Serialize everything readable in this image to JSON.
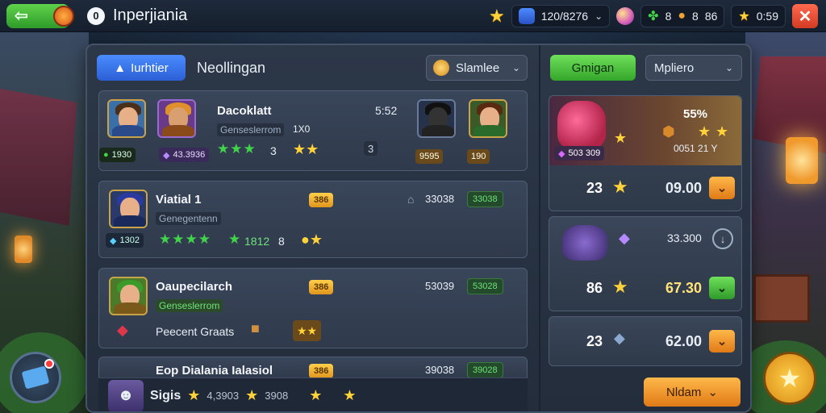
{
  "topbar": {
    "app_title": "Inperjiania",
    "app_logo_glyph": "0",
    "resource": "120/8276",
    "counter_a": "8",
    "counter_b": "8",
    "counter_c": "86",
    "timer": "0:59"
  },
  "tabs": {
    "active": "Iurhtier",
    "second": "Neollingan",
    "sort_label": "Slamlee"
  },
  "heroes": [
    {
      "name": "Dacoklatt",
      "subtitle": "Genseslerrom",
      "subtitle_extra": "1X0",
      "score": "5:52",
      "tag_a": "1930",
      "tag_b": "43.3936",
      "stars_count": "3",
      "misc": "3",
      "ally_a": "9595",
      "ally_b": "190"
    },
    {
      "name": "Viatial 1",
      "subtitle": "Genegentenn",
      "pill": "386",
      "value": "33038",
      "green_value": "33038",
      "tag": "1302",
      "green_stat": "1812",
      "count": "8"
    },
    {
      "name": "Oaupecilarch",
      "subtitle": "Genseslerrom",
      "pill": "386",
      "value": "53039",
      "green_value": "53028",
      "extra_label": "Peecent Graats"
    },
    {
      "name": "Eop Dialania Ialasiol",
      "pill": "386",
      "value": "39038",
      "green_value": "39028"
    }
  ],
  "bottombar": {
    "label": "Sigis",
    "value_a": "4,3903",
    "value_b": "3908"
  },
  "right": {
    "tab_green": "Gmigan",
    "dropdown": "Mpliero",
    "offer_1": {
      "percent": "55%",
      "sub": "0051 21 Y",
      "tag": "503 309",
      "count": "23",
      "price": "09.00"
    },
    "offer_2": {
      "value": "33.300",
      "count": "86",
      "price": "67.30"
    },
    "offer_3": {
      "count": "23",
      "price": "62.00"
    },
    "bottom_button": "Nldam"
  },
  "colors": {
    "accent_blue": "#2c5fd6",
    "accent_green": "#34a52a",
    "accent_orange": "#e07a17",
    "star_gold": "#ffd23a"
  }
}
